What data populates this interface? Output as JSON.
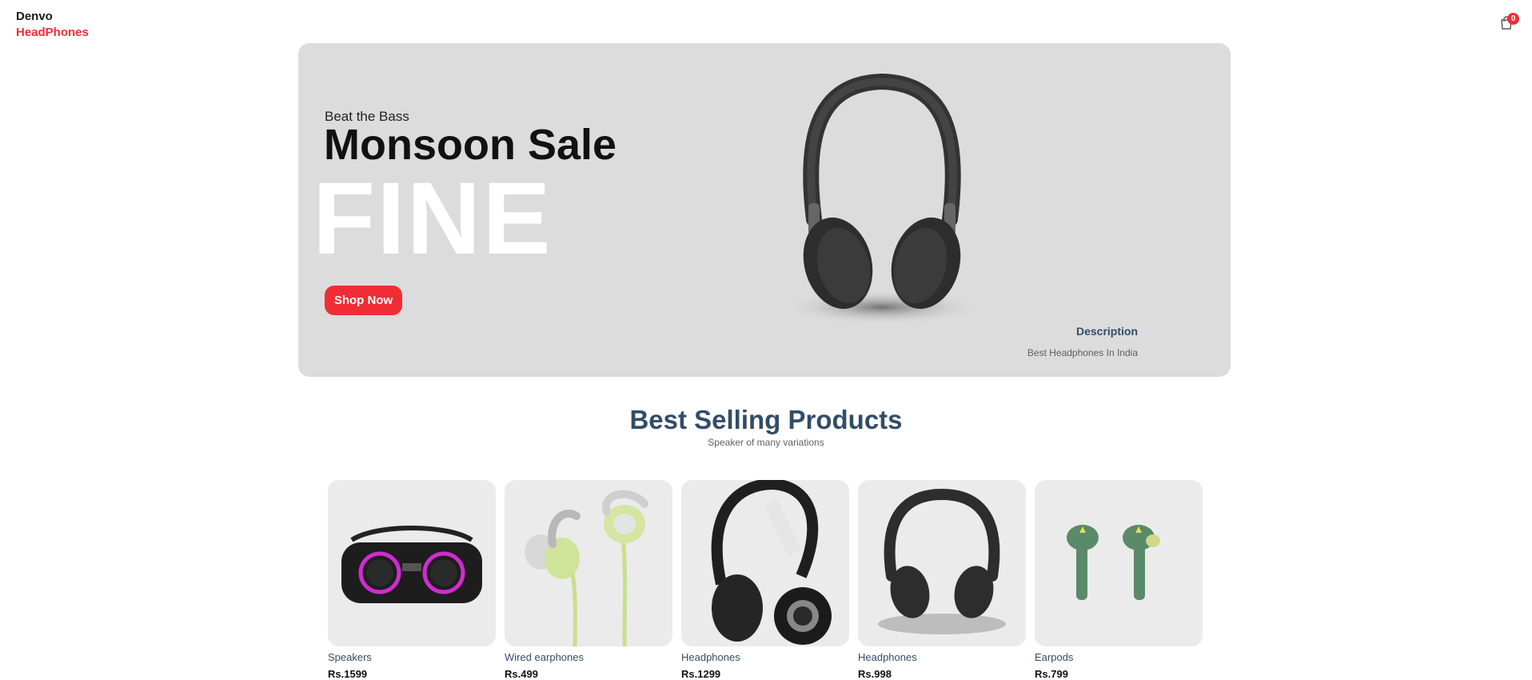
{
  "navbar": {
    "logo_line1": "Denvo",
    "logo_line2": "HeadPhones",
    "cart_count": "0"
  },
  "hero": {
    "small_text": "Beat the Bass",
    "mid_text": "Monsoon Sale",
    "large_text": "FINE",
    "button_label": "Shop Now",
    "desc_title": "Description",
    "desc_text": "Best Headphones In India",
    "image_icon": "headphones-image"
  },
  "products_heading": {
    "title": "Best Selling Products",
    "subtitle": "Speaker of many variations"
  },
  "products": [
    {
      "name": "Speakers",
      "price": "Rs.1599",
      "icon": "speaker-image"
    },
    {
      "name": "Wired earphones",
      "price": "Rs.499",
      "icon": "earphones-image"
    },
    {
      "name": "Headphones",
      "price": "Rs.1299",
      "icon": "headphones-image"
    },
    {
      "name": "Headphones",
      "price": "Rs.998",
      "icon": "headphones-image"
    },
    {
      "name": "Earpods",
      "price": "Rs.799",
      "icon": "earpods-image"
    }
  ],
  "colors": {
    "accent": "#f02d34",
    "heading": "#324d67",
    "hero_bg": "#dcdcdc",
    "card_bg": "#ebebeb"
  }
}
